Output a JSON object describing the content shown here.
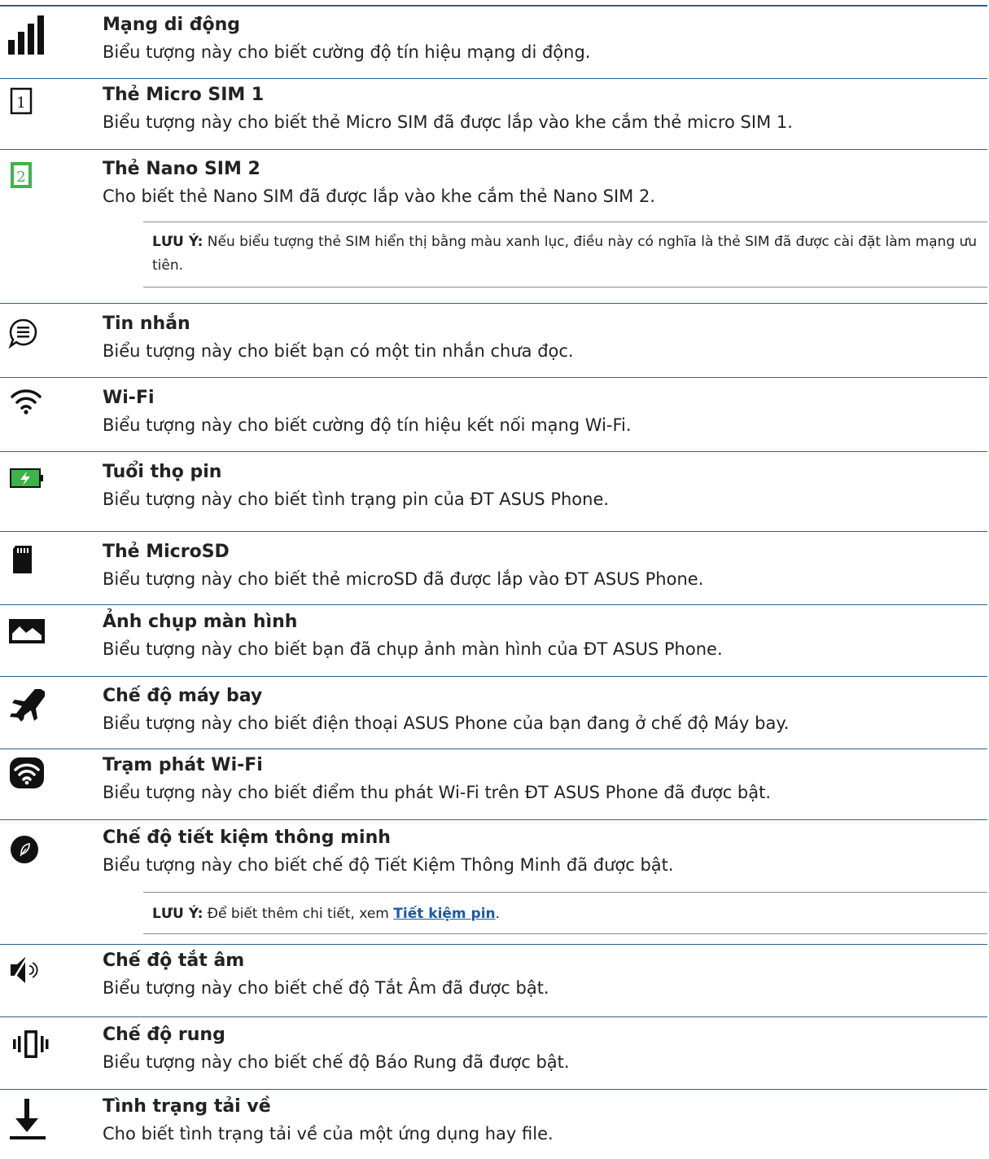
{
  "items": [
    {
      "icon": "signal-bars-icon",
      "title": "Mạng di động",
      "desc": "Biểu tượng này cho biết cường độ tín hiệu mạng di động."
    },
    {
      "icon": "sim-card-1-icon",
      "title": "Thẻ Micro SIM 1",
      "desc": "Biểu tượng này cho biết thẻ Micro SIM đã được lắp vào khe cắm thẻ micro SIM 1.",
      "glyph": "1"
    },
    {
      "icon": "sim-card-2-icon",
      "title": "Thẻ Nano SIM  2",
      "desc": "Cho biết thẻ Nano SIM đã được lắp vào khe cắm thẻ Nano SIM 2.",
      "glyph": "2"
    },
    {
      "icon": "message-icon",
      "title": "Tin nhắn",
      "desc": "Biểu tượng này cho biết bạn có một tin nhắn chưa đọc."
    },
    {
      "icon": "wifi-icon",
      "title": "Wi-Fi",
      "desc": "Biểu tượng này cho biết cường độ tín hiệu kết nối mạng Wi-Fi."
    },
    {
      "icon": "battery-charging-icon",
      "title": "Tuổi thọ pin",
      "desc": "Biểu tượng này cho biết tình trạng pin của ĐT ASUS Phone."
    },
    {
      "icon": "microsd-card-icon",
      "title": "Thẻ MicroSD",
      "desc": "Biểu tượng này cho biết thẻ microSD đã được lắp vào ĐT ASUS Phone."
    },
    {
      "icon": "screenshot-image-icon",
      "title": "Ảnh chụp màn hình",
      "desc": "Biểu tượng này cho biết bạn đã chụp ảnh màn hình của ĐT ASUS Phone."
    },
    {
      "icon": "airplane-icon",
      "title": "Chế độ máy bay",
      "desc": "Biểu tượng này cho biết điện thoại ASUS Phone của bạn đang ở chế độ Máy bay."
    },
    {
      "icon": "wifi-hotspot-icon",
      "title": "Trạm phát Wi-Fi",
      "desc": "Biểu tượng này cho biết điểm thu phát Wi-Fi trên ĐT ASUS Phone đã được bật."
    },
    {
      "icon": "smart-saving-leaf-icon",
      "title": "Chế độ tiết kiệm thông minh",
      "desc": "Biểu tượng này cho biết chế độ Tiết Kiệm Thông Minh đã được bật."
    },
    {
      "icon": "mute-speaker-icon",
      "title": "Chế độ tắt âm",
      "desc": "Biểu tượng này cho biết chế độ Tắt Âm đã được bật."
    },
    {
      "icon": "vibrate-icon",
      "title": "Chế độ rung",
      "desc": "Biểu tượng này cho biết chế độ Báo Rung đã được bật."
    },
    {
      "icon": "download-icon",
      "title": "Tình trạng tải về",
      "desc": "Cho biết tình trạng tải về của một ứng dụng hay file."
    }
  ],
  "notes": {
    "sim": {
      "label": "LƯU Ý:",
      "text": " Nếu biểu tượng thẻ SIM hiển thị bằng màu xanh lục, điều này có nghĩa là thẻ SIM đã được cài đặt làm mạng ưu tiên."
    },
    "battery": {
      "label": "LƯU Ý:",
      "text": "  Để biết thêm chi tiết, xem ",
      "link": "Tiết kiệm pin",
      "after": "."
    }
  },
  "colors": {
    "rule": "#2f5f8e",
    "link": "#1a5aa6",
    "sim_green": "#3cb44a",
    "battery_green": "#3cb44a"
  }
}
